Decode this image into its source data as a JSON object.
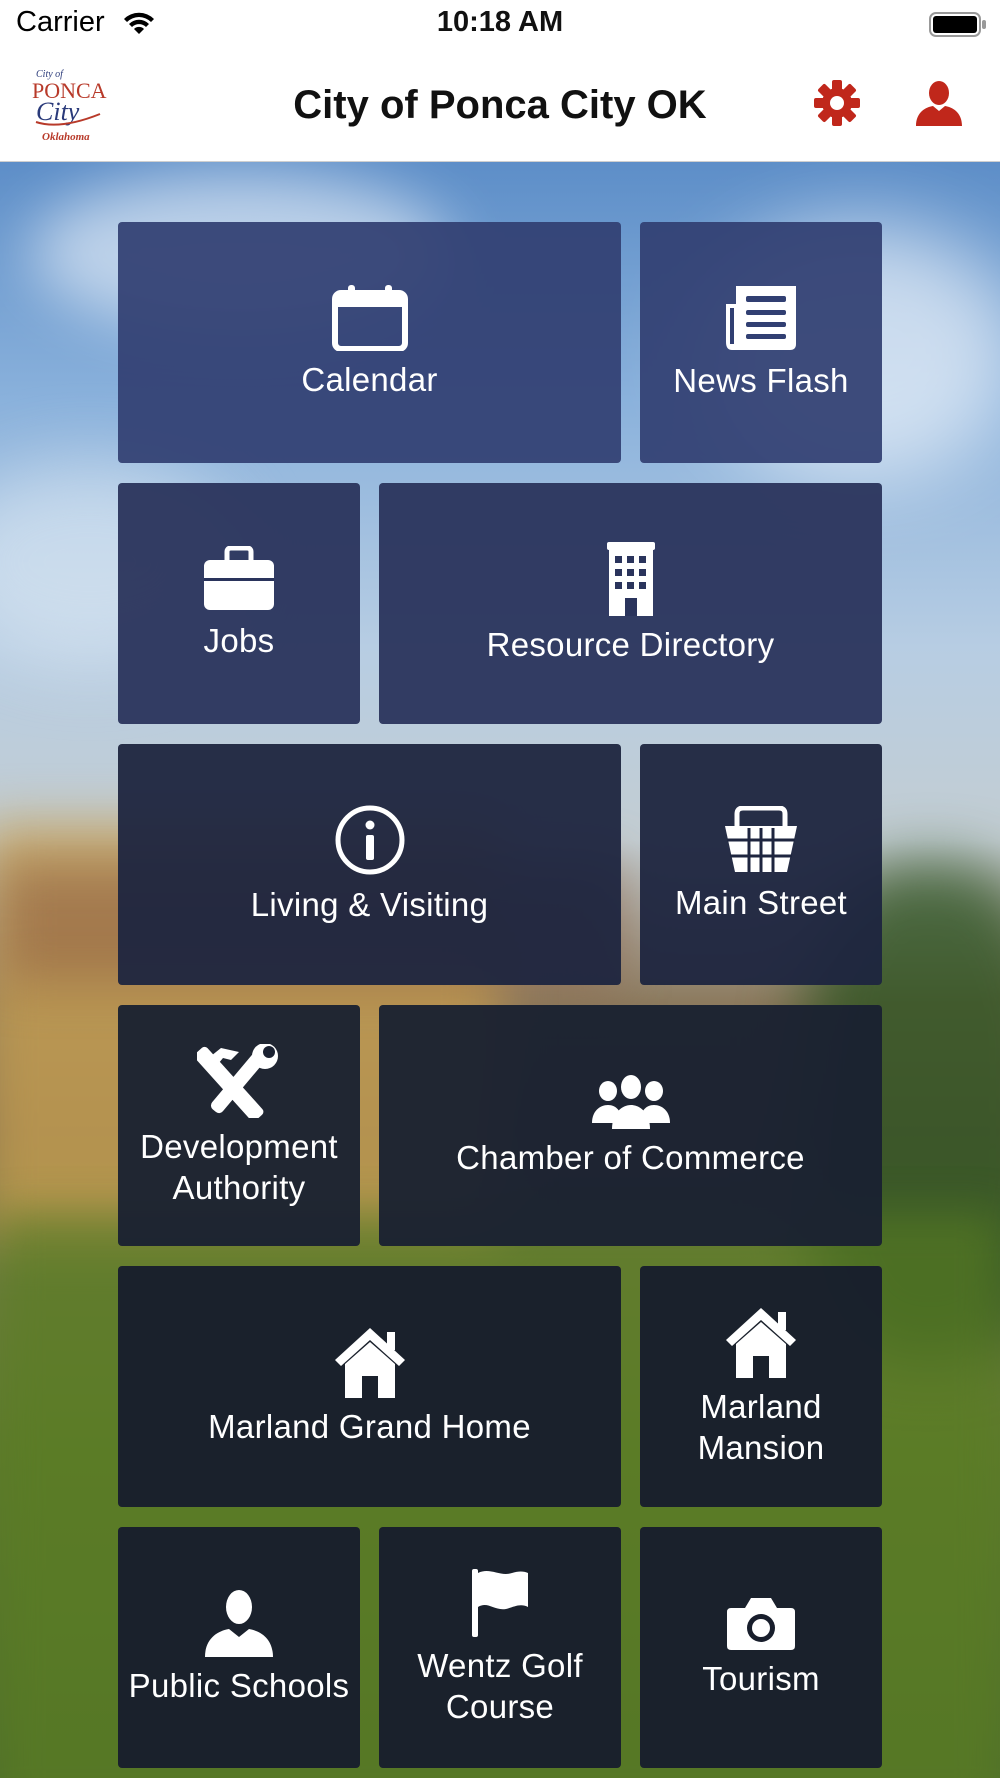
{
  "status_bar": {
    "carrier": "Carrier",
    "time": "10:18 AM"
  },
  "header": {
    "title": "City of Ponca City OK",
    "logo_text": [
      "City of",
      "PONCA",
      "City",
      "Oklahoma"
    ],
    "settings_icon": "gear-icon",
    "profile_icon": "user-icon"
  },
  "colors": {
    "accent": "#c0271b",
    "tile_top": "#313f72",
    "tile_bottom": "#181e2c"
  },
  "tiles": [
    {
      "label": "Calendar",
      "icon": "calendar-icon"
    },
    {
      "label": "News Flash",
      "icon": "newspaper-icon"
    },
    {
      "label": "Jobs",
      "icon": "briefcase-icon"
    },
    {
      "label": "Resource Directory",
      "icon": "building-icon"
    },
    {
      "label": "Living & Visiting",
      "icon": "info-icon"
    },
    {
      "label": "Main Street",
      "icon": "basket-icon"
    },
    {
      "label": "Development Authority",
      "icon": "tools-icon"
    },
    {
      "label": "Chamber of Commerce",
      "icon": "group-icon"
    },
    {
      "label": "Marland Grand Home",
      "icon": "home-icon"
    },
    {
      "label": "Marland Mansion",
      "icon": "home-icon"
    },
    {
      "label": "Public Schools",
      "icon": "person-icon"
    },
    {
      "label": "Wentz Golf Course",
      "icon": "flag-icon"
    },
    {
      "label": "Tourism",
      "icon": "camera-icon"
    }
  ]
}
